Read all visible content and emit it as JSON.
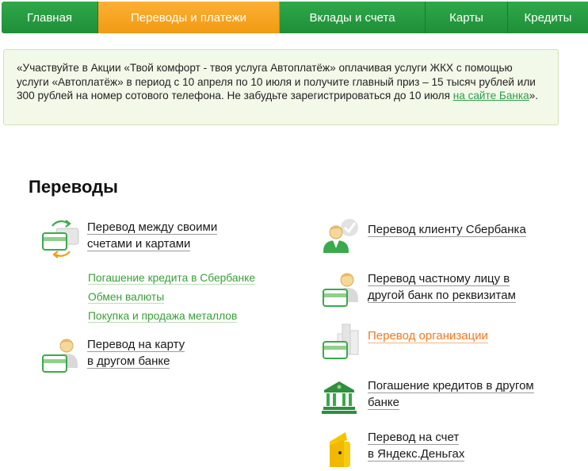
{
  "nav": {
    "items": [
      {
        "label": "Главная",
        "active": false
      },
      {
        "label": "Переводы и платежи",
        "active": true
      },
      {
        "label": "Вклады и счета",
        "active": false
      },
      {
        "label": "Карты",
        "active": false
      },
      {
        "label": "Кредиты",
        "active": false
      }
    ]
  },
  "promo": {
    "text": "«Участвуйте в Акции «Твой комфорт - твоя услуга Автоплатёж» оплачивая услуги ЖКХ с помощью услуги «Автоплатёж» в период с 10 апреля по 10 июля и получите главный приз – 15 тысяч рублей или 300 рублей на номер сотового телефона. Не забудьте зарегистрироваться до 10 июля ",
    "link": "на сайте Банка",
    "tail": "»."
  },
  "section": {
    "title": "Переводы"
  },
  "transfers": {
    "left": [
      {
        "line1": "Перевод между своими",
        "line2": "счетами и картами",
        "icon": "cards-exchange-icon"
      },
      {
        "line1": "Перевод на карту",
        "line2": "в другом банке",
        "icon": "person-card-icon"
      }
    ],
    "sublinks": [
      "Погашение кредита в Сбербанке",
      "Обмен валюты",
      "Покупка и продажа металлов"
    ],
    "right": [
      {
        "line1": "Перевод клиенту Сбербанка",
        "line2": "",
        "icon": "person-sber-icon"
      },
      {
        "line1": "Перевод частному лицу в",
        "line2": "другой банк по реквизитам",
        "icon": "person-card-icon"
      },
      {
        "line1": "Перевод организации",
        "line2": "",
        "icon": "building-card-icon"
      },
      {
        "line1": "Погашение кредитов в другом",
        "line2": "банке",
        "icon": "bank-card-icon"
      },
      {
        "line1": "Перевод на счет",
        "line2": "в Яндекс.Деньгах",
        "icon": "yandex-wallet-icon"
      }
    ]
  },
  "colors": {
    "nav_green": "#2fa84a",
    "nav_active": "#f7a620",
    "link_green": "#3a9d3a",
    "link_orange": "#f2791e"
  }
}
